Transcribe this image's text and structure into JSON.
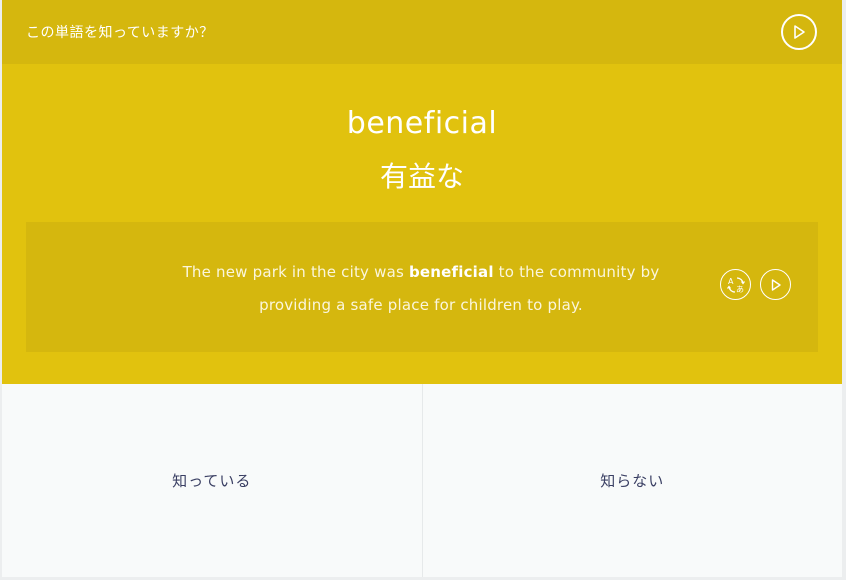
{
  "prompt": "この単語を知っていますか？",
  "word": {
    "english": "beneficial",
    "japanese": "有益な"
  },
  "example": {
    "before": "The new park in the city was ",
    "highlight": "beneficial",
    "after": " to the community by providing a safe place for children to play."
  },
  "answers": {
    "known": "知っている",
    "unknown": "知らない"
  },
  "translate_icon": {
    "top": "A",
    "bottom": "あ"
  },
  "colors": {
    "card": "#e1c20e",
    "header": "#d5b70e",
    "example_box": "#d5b70e",
    "answer_bg": "#f8f9fa",
    "answer_text": "#3a3f63"
  },
  "icons": {
    "header_play": "play-icon",
    "translate": "translate-icon",
    "example_play": "play-icon"
  }
}
